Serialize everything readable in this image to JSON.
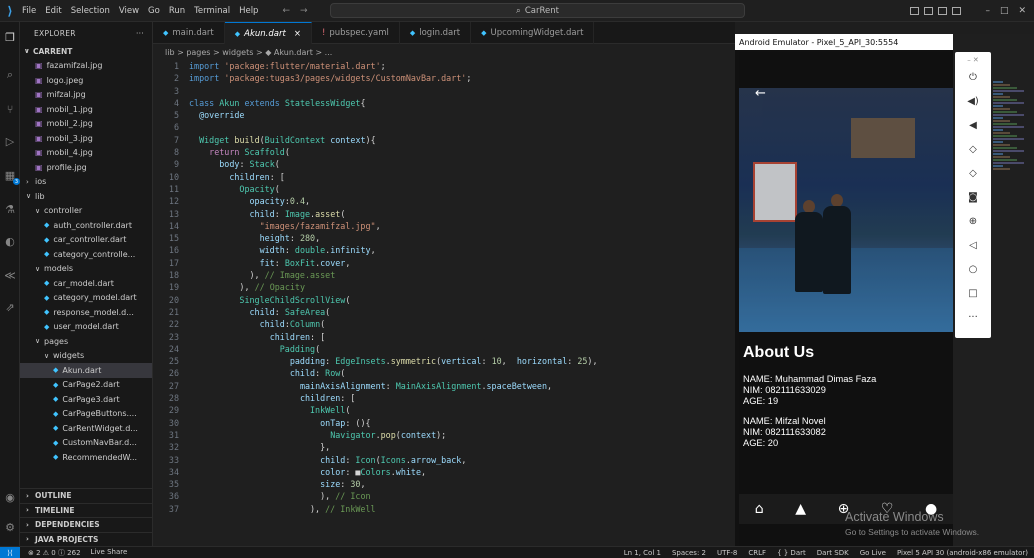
{
  "titlebar": {
    "menu": [
      "File",
      "Edit",
      "Selection",
      "View",
      "Go",
      "Run",
      "Terminal",
      "Help"
    ],
    "search": "CarRent"
  },
  "explorer": {
    "title": "EXPLORER",
    "more": "···",
    "root": "CARRENT",
    "tree": [
      {
        "label": "fazamifzal.jpg",
        "type": "img",
        "indent": 1
      },
      {
        "label": "logo.jpeg",
        "type": "img",
        "indent": 1
      },
      {
        "label": "mifzal.jpg",
        "type": "img",
        "indent": 1
      },
      {
        "label": "mobil_1.jpg",
        "type": "img",
        "indent": 1
      },
      {
        "label": "mobil_2.jpg",
        "type": "img",
        "indent": 1
      },
      {
        "label": "mobil_3.jpg",
        "type": "img",
        "indent": 1
      },
      {
        "label": "mobil_4.jpg",
        "type": "img",
        "indent": 1
      },
      {
        "label": "profile.jpg",
        "type": "img",
        "indent": 1
      },
      {
        "label": "ios",
        "type": "folder-closed",
        "indent": 0
      },
      {
        "label": "lib",
        "type": "folder-open",
        "indent": 0
      },
      {
        "label": "controller",
        "type": "folder-open",
        "indent": 1
      },
      {
        "label": "auth_controller.dart",
        "type": "dart",
        "indent": 2
      },
      {
        "label": "car_controller.dart",
        "type": "dart",
        "indent": 2
      },
      {
        "label": "category_controlle...",
        "type": "dart",
        "indent": 2
      },
      {
        "label": "models",
        "type": "folder-open",
        "indent": 1
      },
      {
        "label": "car_model.dart",
        "type": "dart",
        "indent": 2
      },
      {
        "label": "category_model.dart",
        "type": "dart",
        "indent": 2
      },
      {
        "label": "response_model.d...",
        "type": "dart",
        "indent": 2
      },
      {
        "label": "user_model.dart",
        "type": "dart",
        "indent": 2
      },
      {
        "label": "pages",
        "type": "folder-open",
        "indent": 1
      },
      {
        "label": "widgets",
        "type": "folder-open",
        "indent": 2
      },
      {
        "label": "Akun.dart",
        "type": "dart",
        "indent": 3,
        "active": true
      },
      {
        "label": "CarPage2.dart",
        "type": "dart",
        "indent": 3
      },
      {
        "label": "CarPage3.dart",
        "type": "dart",
        "indent": 3
      },
      {
        "label": "CarPageButtons....",
        "type": "dart",
        "indent": 3
      },
      {
        "label": "CarRentWidget.d...",
        "type": "dart",
        "indent": 3
      },
      {
        "label": "CustomNavBar.d...",
        "type": "dart",
        "indent": 3
      },
      {
        "label": "RecommendedW...",
        "type": "dart",
        "indent": 3
      }
    ],
    "sections": [
      "OUTLINE",
      "TIMELINE",
      "DEPENDENCIES",
      "JAVA PROJECTS"
    ]
  },
  "tabs": [
    {
      "label": "main.dart",
      "active": false
    },
    {
      "label": "Akun.dart",
      "active": true,
      "close": "×"
    },
    {
      "label": "pubspec.yaml",
      "active": false,
      "warn": true
    },
    {
      "label": "login.dart",
      "active": false
    },
    {
      "label": "UpcomingWidget.dart",
      "active": false
    }
  ],
  "breadcrumb": "lib > pages > widgets > ◆ Akun.dart > ...",
  "code_lines": [
    "<span class='kw'>import</span> <span class='str'>'package:flutter/material.dart'</span>;",
    "<span class='kw'>import</span> <span class='str'>'package:tugas3/pages/widgets/CustomNavBar.dart'</span>;",
    "",
    "<span class='kw'>class</span> <span class='cls'>Akun</span> <span class='kw'>extends</span> <span class='cls'>StatelessWidget</span>{",
    "  <span class='prop'>@override</span>",
    "",
    "  <span class='cls'>Widget</span> <span class='fn'>build</span>(<span class='cls'>BuildContext</span> <span class='prop'>context</span>){",
    "    <span class='ctl'>return</span> <span class='cls'>Scaffold</span>(",
    "      <span class='prop'>body</span>: <span class='cls'>Stack</span>(",
    "        <span class='prop'>children</span>: [",
    "          <span class='cls'>Opacity</span>(",
    "            <span class='prop'>opacity</span>:<span class='num'>0.4</span>,",
    "            <span class='prop'>child</span>: <span class='cls'>Image</span>.<span class='fn'>asset</span>(",
    "              <span class='str'>\"images/fazamifzal.jpg\"</span>,",
    "              <span class='prop'>height</span>: <span class='num'>280</span>,",
    "              <span class='prop'>width</span>: <span class='cls'>double</span>.<span class='prop'>infinity</span>,",
    "              <span class='prop'>fit</span>: <span class='cls'>BoxFit</span>.<span class='prop'>cover</span>,",
    "            ), <span class='cmt'>// Image.asset</span>",
    "          ), <span class='cmt'>// Opacity</span>",
    "          <span class='cls'>SingleChildScrollView</span>(",
    "            <span class='prop'>child</span>: <span class='cls'>SafeArea</span>(",
    "              <span class='prop'>child</span>:<span class='cls'>Column</span>(",
    "                <span class='prop'>children</span>: [",
    "                  <span class='cls'>Padding</span>(",
    "                    <span class='prop'>padding</span>: <span class='cls'>EdgeInsets</span>.<span class='fn'>symmetric</span>(<span class='prop'>vertical</span>: <span class='num'>10</span>,  <span class='prop'>horizontal</span>: <span class='num'>25</span>),",
    "                    <span class='prop'>child</span>: <span class='cls'>Row</span>(",
    "                      <span class='prop'>mainAxisAlignment</span>: <span class='cls'>MainAxisAlignment</span>.<span class='prop'>spaceBetween</span>,",
    "                      <span class='prop'>children</span>: [",
    "                        <span class='cls'>InkWell</span>(",
    "                          <span class='prop'>onTap</span>: (){",
    "                            <span class='cls'>Navigator</span>.<span class='fn'>pop</span>(<span class='prop'>context</span>);",
    "                          },",
    "                          <span class='prop'>child</span>: <span class='cls'>Icon</span>(<span class='cls'>Icons</span>.<span class='prop'>arrow_back</span>,",
    "                          <span class='prop'>color</span>: ■<span class='cls'>Colors</span>.<span class='prop'>white</span>,",
    "                          <span class='prop'>size</span>: <span class='num'>30</span>,",
    "                          ), <span class='cmt'>// Icon</span>",
    "                        ), <span class='cmt'>// InkWell</span>"
  ],
  "emulator": {
    "title": "Android Emulator - Pixel_5_API_30:5554",
    "about_title": "About Us",
    "members": [
      {
        "name": "NAME: Muhammad Dimas Faza",
        "nim": "NIM: 082111633029",
        "age": "AGE: 19"
      },
      {
        "name": "NAME: Mifzal Novel",
        "nim": "NIM: 082111633082",
        "age": "AGE: 20"
      }
    ]
  },
  "watermark": {
    "line1": "Activate Windows",
    "line2": "Go to Settings to activate Windows."
  },
  "statusbar": {
    "problems": "⊗ 2  ⚠ 0  ⓘ 262",
    "live_share": "Live Share",
    "position": "Ln 1, Col 1",
    "spaces": "Spaces: 2",
    "encoding": "UTF-8",
    "eol": "CRLF",
    "language": "{ } Dart",
    "sdk": "Dart SDK",
    "golive": "Go Live",
    "device": "Pixel 5 API 30 (android-x86 emulator)"
  }
}
